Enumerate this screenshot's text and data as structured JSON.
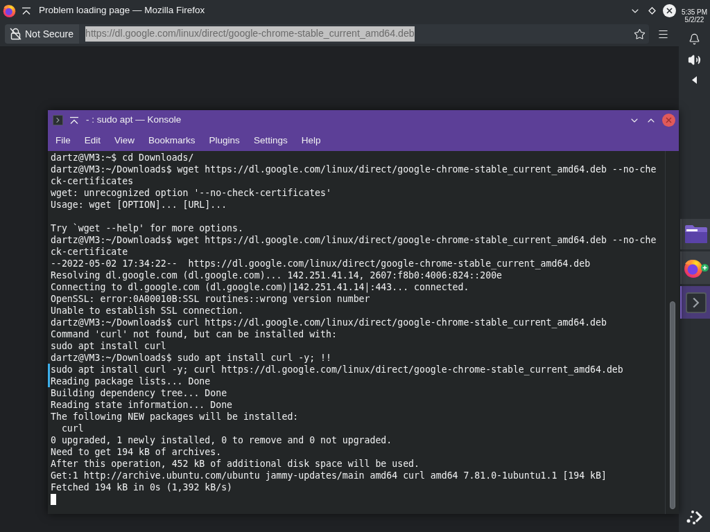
{
  "browser": {
    "window_title": "Problem loading page — Mozilla Firefox",
    "security_label": "Not Secure",
    "url": {
      "value": "https://dl.google.com/linux/direct/google-chrome-stable_current_amd64.deb",
      "selected": true
    }
  },
  "konsole": {
    "window_title": "- : sudo apt — Konsole",
    "menu": [
      "File",
      "Edit",
      "View",
      "Bookmarks",
      "Plugins",
      "Settings",
      "Help"
    ],
    "terminal": {
      "lines": [
        {
          "kind": "text",
          "text": "dartz@VM3:~$ cd Downloads/",
          "marked": false
        },
        {
          "kind": "text",
          "text": "dartz@VM3:~/Downloads$ wget https://dl.google.com/linux/direct/google-chrome-stable_current_amd64.deb --no-che",
          "marked": false
        },
        {
          "kind": "text",
          "text": "ck-certificates",
          "marked": false
        },
        {
          "kind": "text",
          "text": "wget: unrecognized option '--no-check-certificates'",
          "marked": false
        },
        {
          "kind": "text",
          "text": "Usage: wget [OPTION]... [URL]...",
          "marked": false
        },
        {
          "kind": "blank"
        },
        {
          "kind": "text",
          "text": "Try `wget --help' for more options.",
          "marked": false
        },
        {
          "kind": "text",
          "text": "dartz@VM3:~/Downloads$ wget https://dl.google.com/linux/direct/google-chrome-stable_current_amd64.deb --no-che",
          "marked": false
        },
        {
          "kind": "text",
          "text": "ck-certificate",
          "marked": false
        },
        {
          "kind": "text",
          "text": "--2022-05-02 17:34:22--  https://dl.google.com/linux/direct/google-chrome-stable_current_amd64.deb",
          "marked": false
        },
        {
          "kind": "text",
          "text": "Resolving dl.google.com (dl.google.com)... 142.251.41.14, 2607:f8b0:4006:824::200e",
          "marked": false
        },
        {
          "kind": "text",
          "text": "Connecting to dl.google.com (dl.google.com)|142.251.41.14|:443... connected.",
          "marked": false
        },
        {
          "kind": "text",
          "text": "OpenSSL: error:0A00010B:SSL routines::wrong version number",
          "marked": false
        },
        {
          "kind": "text",
          "text": "Unable to establish SSL connection.",
          "marked": false
        },
        {
          "kind": "text",
          "text": "dartz@VM3:~/Downloads$ curl https://dl.google.com/linux/direct/google-chrome-stable_current_amd64.deb",
          "marked": false
        },
        {
          "kind": "text",
          "text": "Command 'curl' not found, but can be installed with:",
          "marked": false
        },
        {
          "kind": "text",
          "text": "sudo apt install curl",
          "marked": false
        },
        {
          "kind": "text",
          "text": "dartz@VM3:~/Downloads$ sudo apt install curl -y; !!",
          "marked": false
        },
        {
          "kind": "text",
          "text": "sudo apt install curl -y; curl https://dl.google.com/linux/direct/google-chrome-stable_current_amd64.deb",
          "marked": true
        },
        {
          "kind": "text",
          "text": "Reading package lists... Done",
          "marked": true
        },
        {
          "kind": "text",
          "text": "Building dependency tree... Done",
          "marked": false
        },
        {
          "kind": "text",
          "text": "Reading state information... Done",
          "marked": false
        },
        {
          "kind": "text",
          "text": "The following NEW packages will be installed:",
          "marked": false
        },
        {
          "kind": "text",
          "text": "  curl",
          "marked": false
        },
        {
          "kind": "text",
          "text": "0 upgraded, 1 newly installed, 0 to remove and 0 not upgraded.",
          "marked": false
        },
        {
          "kind": "text",
          "text": "Need to get 194 kB of archives.",
          "marked": false
        },
        {
          "kind": "text",
          "text": "After this operation, 452 kB of additional disk space will be used.",
          "marked": false
        },
        {
          "kind": "text",
          "text": "Get:1 http://archive.ubuntu.com/ubuntu jammy-updates/main amd64 curl amd64 7.81.0-1ubuntu1.1 [194 kB]",
          "marked": false
        },
        {
          "kind": "text",
          "text": "Fetched 194 kB in 0s (1,392 kB/s)",
          "marked": false
        }
      ],
      "cursor_visible": true
    }
  },
  "panel": {
    "clock": {
      "time": "5:35 PM",
      "date": "5/2/22"
    },
    "tasks": [
      {
        "kind": "folder",
        "selected": false
      },
      {
        "kind": "browser",
        "selected": false
      },
      {
        "kind": "terminal",
        "selected": true
      }
    ]
  }
}
